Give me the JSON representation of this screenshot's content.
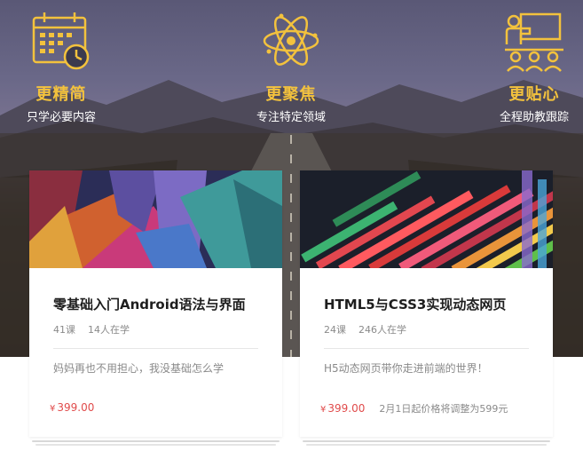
{
  "features": [
    {
      "icon": "calendar-clock-icon",
      "title": "更精简",
      "subtitle": "只学必要内容"
    },
    {
      "icon": "atom-icon",
      "title": "更聚焦",
      "subtitle": "专注特定领域"
    },
    {
      "icon": "teacher-board-icon",
      "title": "更贴心",
      "subtitle": "全程助教跟踪"
    }
  ],
  "courses": [
    {
      "title": "零基础入门Android语法与界面",
      "lessons": "41课",
      "students": "14人在学",
      "description": "妈妈再也不用担心，我没基础怎么学",
      "currency": "¥",
      "price": "399.00",
      "note": ""
    },
    {
      "title": "HTML5与CSS3实现动态网页",
      "lessons": "24课",
      "students": "246人在学",
      "description": "H5动态网页带你走进前端的世界！",
      "currency": "¥",
      "price": "399.00",
      "note": "2月1日起价格将调整为599元"
    }
  ],
  "colors": {
    "accent_gold": "#f3c23d",
    "price_red": "#e04b4b",
    "muted_text": "#8a8a8a"
  }
}
